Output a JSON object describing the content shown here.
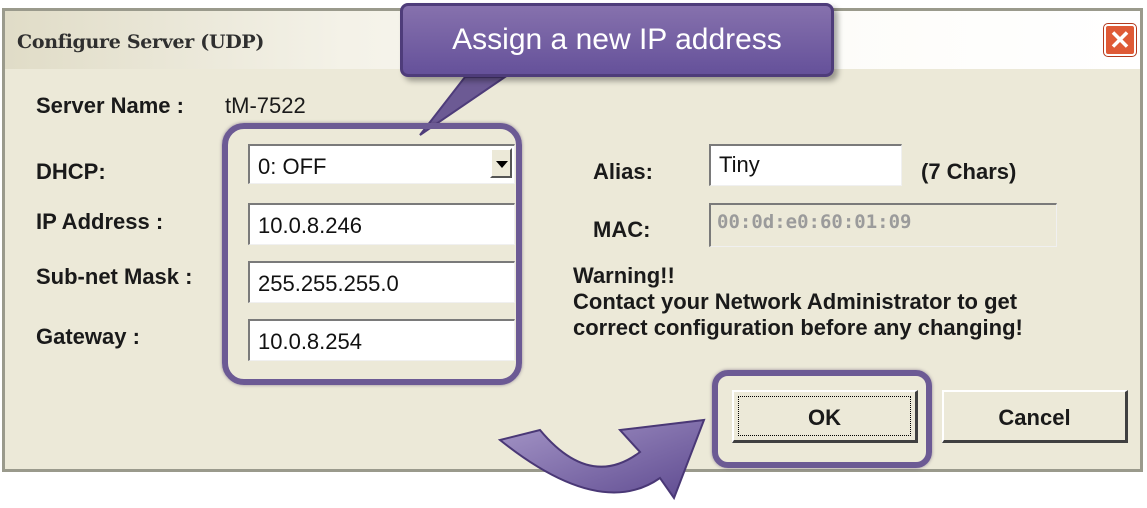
{
  "window": {
    "title": "Configure Server (UDP)",
    "close_glyph": "✕"
  },
  "callout": {
    "text": "Assign a new IP address"
  },
  "server": {
    "label": "Server Name :",
    "value": "tM-7522"
  },
  "dhcp": {
    "label": "DHCP:",
    "value": "0: OFF"
  },
  "ip": {
    "label": "IP Address :",
    "value": "10.0.8.246"
  },
  "mask": {
    "label": "Sub-net Mask :",
    "value": "255.255.255.0"
  },
  "gateway": {
    "label": "Gateway :",
    "value": "10.0.8.254"
  },
  "alias": {
    "label": "Alias:",
    "value": "Tiny",
    "hint": "(7 Chars)"
  },
  "mac": {
    "label": "MAC:",
    "value": "00:0d:e0:60:01:09"
  },
  "warning": {
    "line1": "Warning!!",
    "line2": "Contact your Network Administrator to get",
    "line3": "correct  configuration before any changing!"
  },
  "buttons": {
    "ok": "OK",
    "cancel": "Cancel"
  },
  "colors": {
    "highlight": "#6c5a94",
    "close": "#df5a36",
    "dialog_bg": "#ece9d8"
  }
}
